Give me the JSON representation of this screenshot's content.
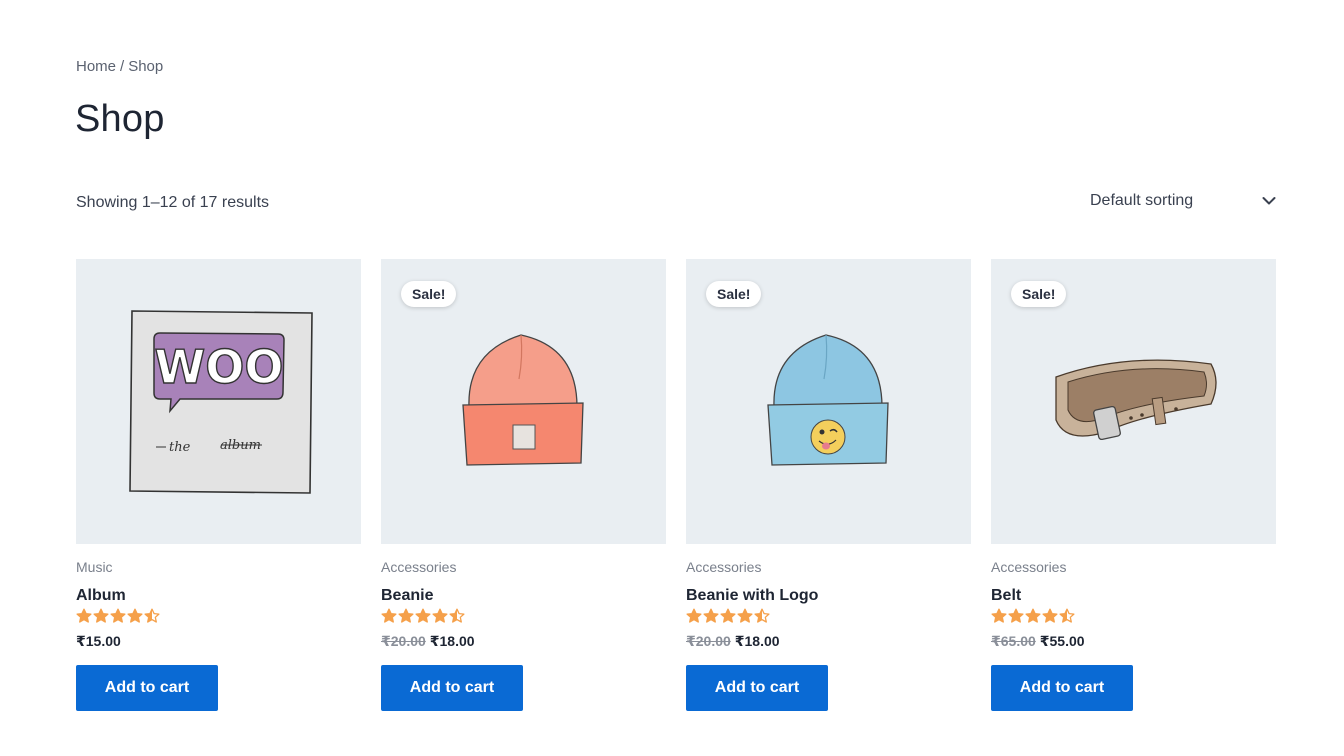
{
  "breadcrumb": {
    "home": "Home",
    "separator": "/",
    "current": "Shop"
  },
  "page_title": "Shop",
  "result_count": "Showing 1–12 of 17 results",
  "sorting": {
    "selected": "Default sorting",
    "icon": "chevron-down-icon"
  },
  "colors": {
    "accent": "#0a6ad4",
    "star": "#f5a04a",
    "thumb_bg": "#e9eef2"
  },
  "products": [
    {
      "category": "Music",
      "name": "Album",
      "rating": 4.5,
      "rating_max": 5,
      "old_price": "",
      "price": "₹15.00",
      "sale_badge": "",
      "button": "Add to cart",
      "image": "woo-album-icon"
    },
    {
      "category": "Accessories",
      "name": "Beanie",
      "rating": 4.5,
      "rating_max": 5,
      "old_price": "₹20.00",
      "price": "₹18.00",
      "sale_badge": "Sale!",
      "button": "Add to cart",
      "image": "orange-beanie-icon"
    },
    {
      "category": "Accessories",
      "name": "Beanie with Logo",
      "rating": 4.5,
      "rating_max": 5,
      "old_price": "₹20.00",
      "price": "₹18.00",
      "sale_badge": "Sale!",
      "button": "Add to cart",
      "image": "blue-beanie-icon"
    },
    {
      "category": "Accessories",
      "name": "Belt",
      "rating": 4.5,
      "rating_max": 5,
      "old_price": "₹65.00",
      "price": "₹55.00",
      "sale_badge": "Sale!",
      "button": "Add to cart",
      "image": "belt-icon"
    }
  ]
}
